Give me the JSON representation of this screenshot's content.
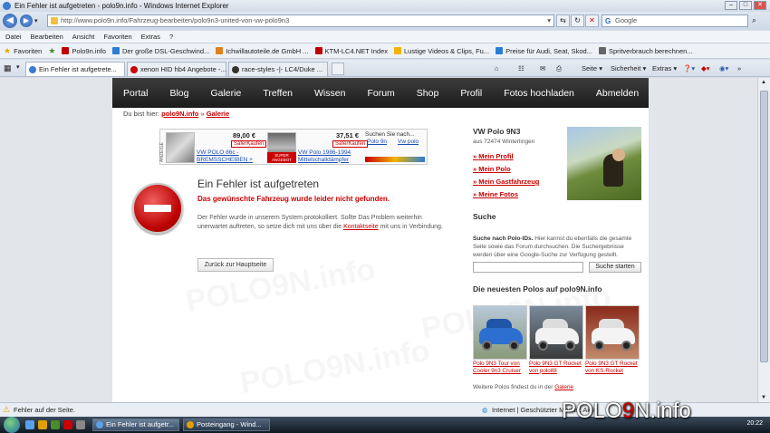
{
  "browser": {
    "window_title": "Ein Fehler ist aufgetreten - polo9n.info - Windows Internet Explorer",
    "url": "http://www.polo9n.info/Fahrzeug-bearbeiten/polo9n3-united-von-vw-polo9n3",
    "search_placeholder": "Google",
    "menu": [
      "Datei",
      "Bearbeiten",
      "Ansicht",
      "Favoriten",
      "Extras",
      "?"
    ],
    "favorites_label": "Favoriten",
    "favorites": [
      {
        "label": "Polo9n.info",
        "color": "#c00000"
      },
      {
        "label": "Der große DSL-Geschwind...",
        "color": "#2a7dd6"
      },
      {
        "label": "Ichwillautoteile.de GmbH ...",
        "color": "#e0801a"
      },
      {
        "label": "KTM-LC4.NET Index",
        "color": "#c00000"
      },
      {
        "label": "Lustige Videos & Clips, Fu...",
        "color": "#f0b400"
      },
      {
        "label": "Preise für Audi, Seat, Skod...",
        "color": "#2a7dd6"
      },
      {
        "label": "Spritverbrauch berechnen...",
        "color": "#666666"
      }
    ],
    "tabs": [
      {
        "label": "Ein Fehler ist aufgetrete..."
      },
      {
        "label": "xenon HID hb4 Angebote -..."
      },
      {
        "label": "race-styles -|- LC4/Duke ..."
      }
    ],
    "commands": [
      "Seite",
      "Sicherheit",
      "Extras"
    ],
    "status_left": "Fehler auf der Seite.",
    "status_right": "Internet | Geschützter Modus: Aktiv"
  },
  "site": {
    "nav": [
      "Portal",
      "Blog",
      "Galerie",
      "Treffen",
      "Wissen",
      "Forum",
      "Shop",
      "Profil",
      "Fotos hochladen",
      "Abmelden"
    ],
    "breadcrumb_prefix": "Du bist hier:",
    "breadcrumb_home": "polo9N.info",
    "breadcrumb_sep": "»",
    "breadcrumb_current": "Galerie",
    "ad": {
      "vertical_label": "ANZEIGE",
      "item1_price": "89,00 €",
      "item1_badge": "SaferKaufen",
      "item1_text": "VW POLO 86c - BREMSSCHEIBEN +",
      "item2_price": "37,51 €",
      "item2_badge": "SaferKaufen",
      "item2_text": "VW Polo 1986-1994 Mittelschalldämpfer",
      "item2_tag": "SUPER ANGEBOT",
      "search_label": "Suchen Sie nach...",
      "search_link1": "Polo 9n",
      "search_link2": "Vw polo"
    },
    "error": {
      "title": "Ein Fehler ist aufgetreten",
      "subtitle": "Das gewünschte Fahrzeug wurde leider nicht gefunden.",
      "body_pre": "Der Fehler wurde in unserem System protokolliert. Sollte Das Problem weiterhin unerwartet auftreten, so setze dich mit uns über die",
      "body_link": "Kontaktseite",
      "body_post": "mit uns in Verbindung.",
      "back_button": "Zurück zur Hauptseite"
    },
    "profile": {
      "name": "VW Polo 9N3",
      "location": "aus 72474 Winterlingen",
      "links": [
        "Mein Profil",
        "Mein Polo",
        "Mein Gastfahrzeug",
        "Meine Fotos"
      ]
    },
    "search": {
      "heading": "Suche",
      "text_bold": "Suche nach Polo-IDs.",
      "text_rest": "Hier kannst du ebenfalls die gesamte Seite sowie das Forum durchsuchen. Die Suchergebnisse werden über eine Google-Suche zur Verfügung gestellt.",
      "button": "Suche starten"
    },
    "newest": {
      "heading": "Die neuesten Polos auf polo9N.info",
      "cars": [
        {
          "caption": "Polo 9N3 Tour von Cooler 9n3 Cruiser",
          "color": "#2d6fd0"
        },
        {
          "caption": "Polo 9N3 GT Rocket von polo88",
          "color": "#f2f2f2"
        },
        {
          "caption": "Polo 9N3 GT Rocket von KS-Rocket",
          "color": "#f4f4f4"
        }
      ],
      "more_pre": "Weitere Polos findest du in der",
      "more_link": "Galerie"
    },
    "watermark": "POLO9N.info"
  },
  "taskbar": {
    "tasks": [
      "Ein Fehler ist aufgetr...",
      "Posteingang - Wind..."
    ],
    "clock": "20:22"
  },
  "overlay_watermark": {
    "pre": "POLO",
    "mid": "9",
    "post": "N.info"
  }
}
